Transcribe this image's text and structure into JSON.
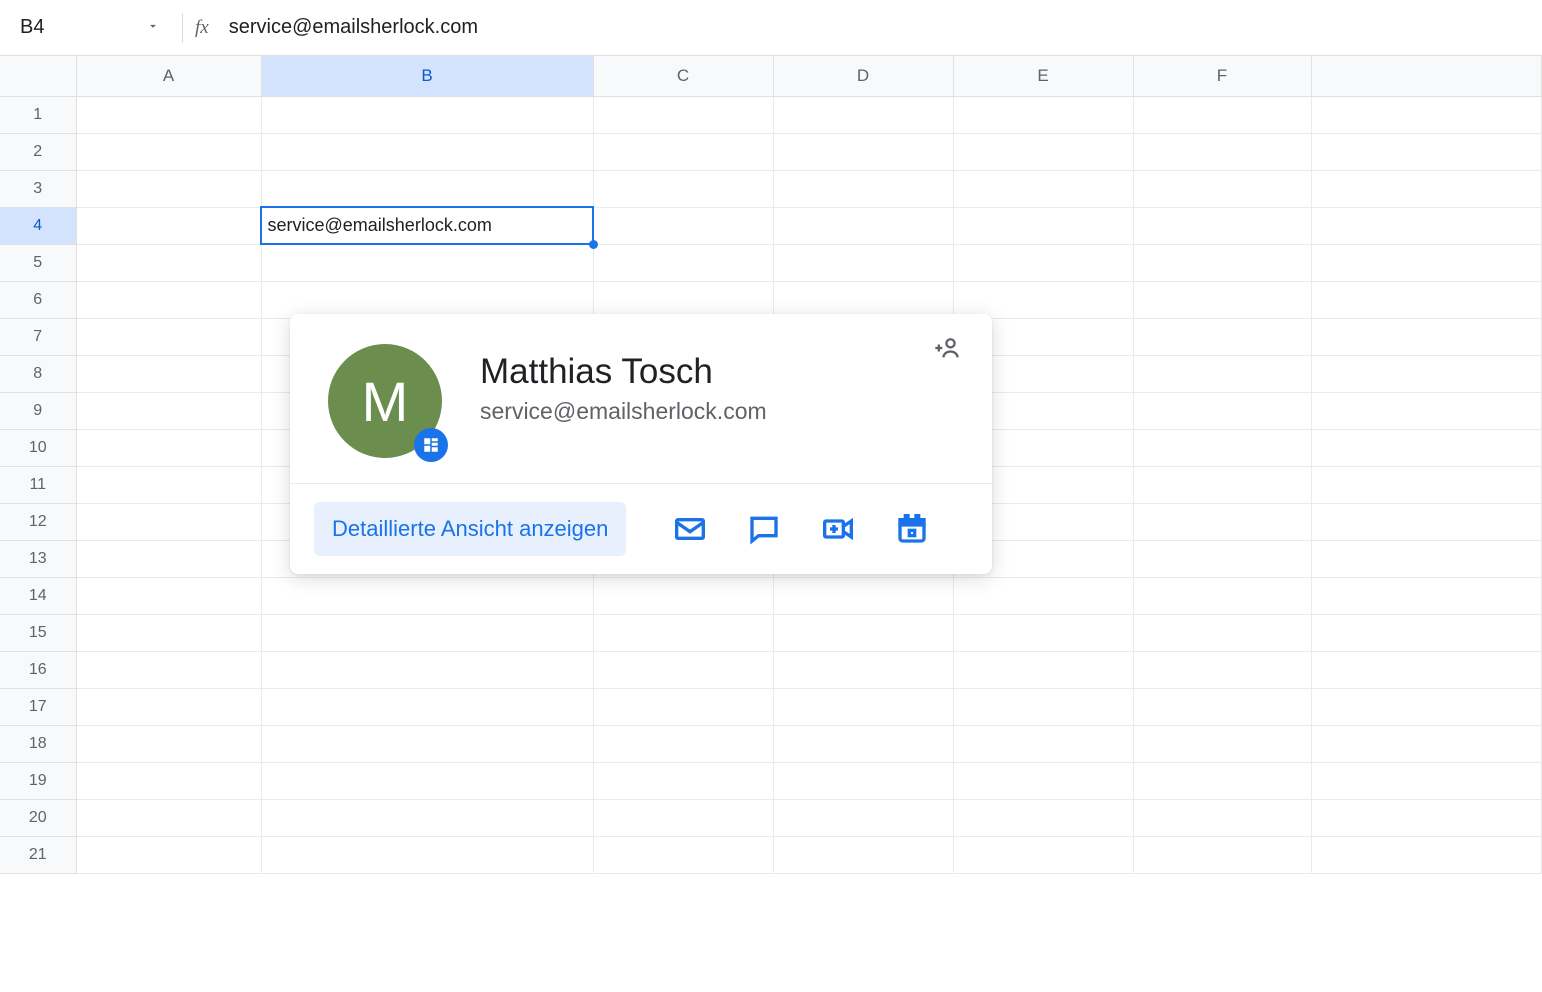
{
  "formula_bar": {
    "cell_ref": "B4",
    "formula_value": "service@emailsherlock.com"
  },
  "columns": [
    "A",
    "B",
    "C",
    "D",
    "E",
    "F"
  ],
  "rows": [
    "1",
    "2",
    "3",
    "4",
    "5",
    "6",
    "7",
    "8",
    "9",
    "10",
    "11",
    "12",
    "13",
    "14",
    "15",
    "16",
    "17",
    "18",
    "19",
    "20",
    "21"
  ],
  "selected_column": "B",
  "selected_row": "4",
  "cells": {
    "B4": "service@emailsherlock.com"
  },
  "contact_card": {
    "avatar_initial": "M",
    "name": "Matthias Tosch",
    "email": "service@emailsherlock.com",
    "detail_button": "Detaillierte Ansicht anzeigen"
  }
}
